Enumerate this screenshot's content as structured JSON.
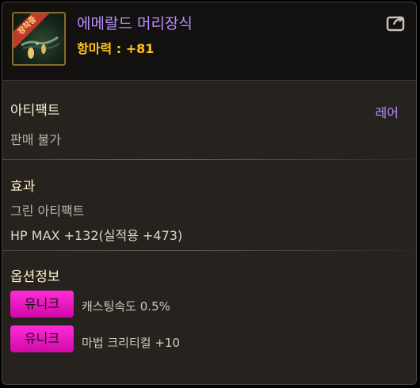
{
  "header": {
    "item_name": "에메랄드 머리장식",
    "item_stat": "항마력 : +81",
    "icon_badge": "장착중"
  },
  "sections": {
    "artifact": {
      "title": "아티팩트",
      "rarity": "레어",
      "note": "판매 불가"
    },
    "effect": {
      "title": "효과",
      "lines": [
        "그린 아티팩트",
        "HP MAX +132(실적용 +473)"
      ]
    },
    "options": {
      "title": "옵션정보",
      "items": [
        {
          "badge": "유니크",
          "text": "캐스팅속도 0.5%"
        },
        {
          "badge": "유니크",
          "text": "마법 크리티컬 +10"
        }
      ]
    }
  },
  "colors": {
    "item_name": "#b98cff",
    "stat": "#ffc61a",
    "unique_badge": "#e814c4"
  },
  "icons": {
    "share": "share-icon",
    "item": "emerald-headpiece-icon"
  }
}
